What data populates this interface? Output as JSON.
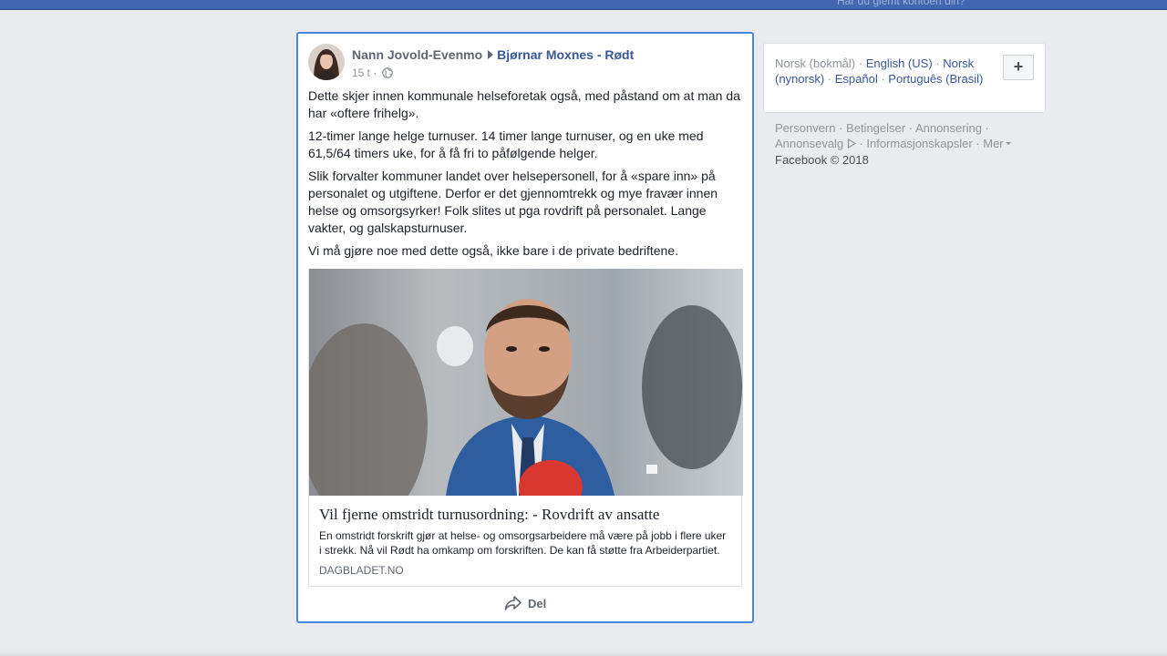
{
  "topbar": {
    "forgot_text": "Har du glemt kontoen din?"
  },
  "post": {
    "author": "Nann Jovold-Evenmo",
    "target": "Bjørnar Moxnes - Rødt",
    "time": "15 t",
    "meta_separator": "·",
    "paragraphs": [
      "Dette skjer innen kommunale helseforetak også, med påstand om at man da har «oftere frihelg».",
      "12-timer lange helge turnuser. 14 timer lange turnuser, og en uke med 61,5/64 timers uke, for å få fri to påfølgende helger.",
      "Slik forvalter kommuner landet over helsepersonell, for å «spare inn» på personalet og utgiftene. Derfor er det gjennomtrekk og mye fravær innen helse og omsorgsyrker! Folk slites ut pga rovdrift på personalet. Lange vakter, og galskapsturnuser.",
      "Vi må gjøre noe med dette også, ikke bare i de private bedriftene."
    ],
    "link": {
      "title": "Vil fjerne omstridt turnusordning: - Rovdrift av ansatte",
      "description": "En omstridt forskrift gjør at helse- og omsorgsarbeidere må være på jobb i flere uker i strekk. Nå vil Rødt ha omkamp om forskriften. De kan få støtte fra Arbeiderpartiet.",
      "domain": "DAGBLADET.NO"
    },
    "share_label": "Del"
  },
  "languages": {
    "current": "Norsk (bokmål)",
    "options": [
      "English (US)",
      "Norsk (nynorsk)",
      "Español",
      "Português (Brasil)"
    ],
    "add_label": "+"
  },
  "footer": {
    "links": [
      "Personvern",
      "Betingelser",
      "Annonsering",
      "Annonsevalg",
      "Informasjonskapsler",
      "Mer"
    ],
    "copyright": "Facebook © 2018"
  },
  "colors": {
    "topbar": "#4267b2",
    "link": "#385898",
    "focus_border": "#4a86d8",
    "background": "#e9ebee"
  }
}
